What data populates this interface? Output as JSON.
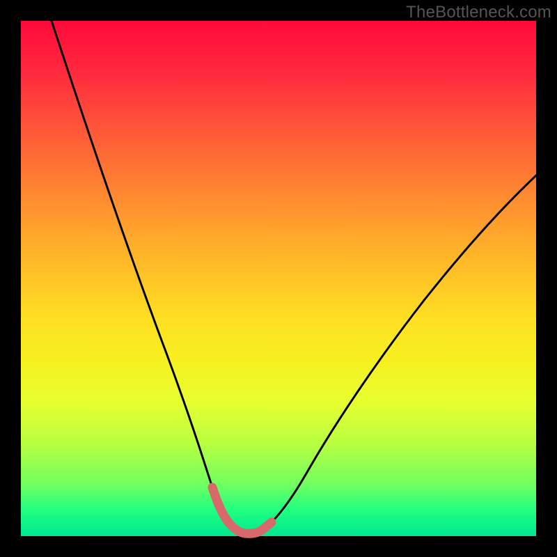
{
  "watermark": "TheBottleneck.com",
  "colors": {
    "background": "#000000",
    "curve_black": "#000000",
    "curve_highlight": "#d66a6a"
  },
  "chart_data": {
    "type": "line",
    "title": "",
    "xlabel": "",
    "ylabel": "",
    "xlim": [
      0,
      100
    ],
    "ylim": [
      0,
      100
    ],
    "series": [
      {
        "name": "bottleneck-curve",
        "x": [
          6,
          10,
          14,
          18,
          22,
          26,
          30,
          33,
          36,
          38,
          40,
          42,
          44,
          46,
          48,
          52,
          56,
          62,
          70,
          80,
          90,
          100
        ],
        "y": [
          100,
          84,
          70,
          58,
          47,
          37,
          28,
          21,
          14,
          9,
          5,
          2,
          1,
          2,
          5,
          10,
          16,
          24,
          34,
          46,
          56,
          65
        ]
      }
    ],
    "annotations": [
      {
        "name": "optimal-region",
        "x_range": [
          36,
          48
        ],
        "y_range": [
          0,
          14
        ],
        "note": "pink highlighted bottom of curve"
      }
    ]
  }
}
